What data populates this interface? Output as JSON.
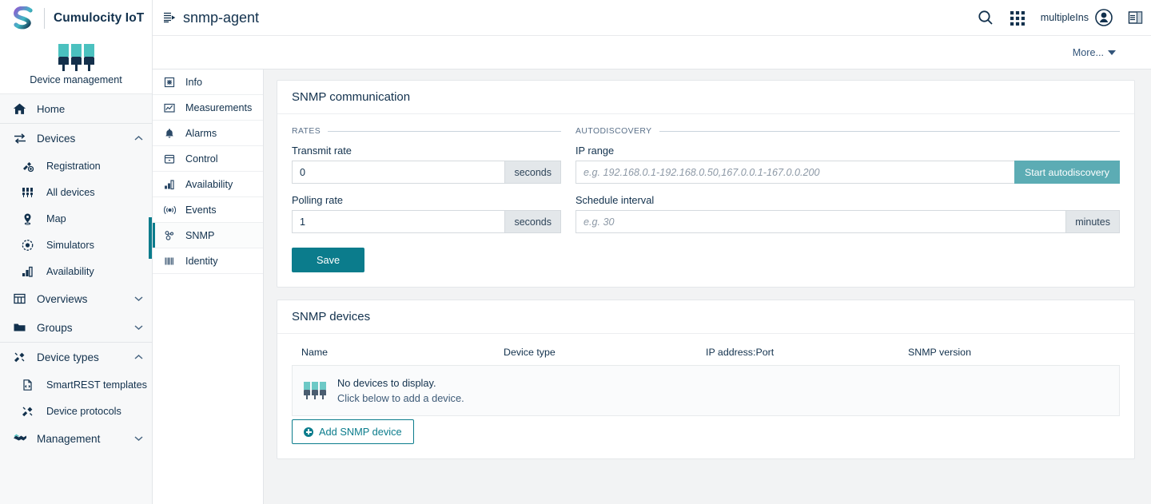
{
  "brand": {
    "name": "Cumulocity IoT",
    "logo_icon": "cumulocity-s-logo",
    "app_title": "Device management",
    "app_icon": "device-management-icon"
  },
  "sidebar": {
    "items": [
      {
        "label": "Home",
        "icon": "home-icon",
        "type": "item"
      },
      {
        "label": "Devices",
        "icon": "devices-icon",
        "type": "group",
        "chevron": "chevron-up",
        "expanded": true
      },
      {
        "label": "Registration",
        "icon": "registration-icon",
        "type": "sub"
      },
      {
        "label": "All devices",
        "icon": "all-devices-icon",
        "type": "sub"
      },
      {
        "label": "Map",
        "icon": "map-pin-icon",
        "type": "sub"
      },
      {
        "label": "Simulators",
        "icon": "simulators-icon",
        "type": "sub"
      },
      {
        "label": "Availability",
        "icon": "availability-icon",
        "type": "sub"
      },
      {
        "label": "Overviews",
        "icon": "overviews-icon",
        "type": "group",
        "chevron": "chevron-down",
        "expanded": false
      },
      {
        "label": "Groups",
        "icon": "folder-icon",
        "type": "group",
        "chevron": "chevron-down",
        "expanded": false
      },
      {
        "label": "Device types",
        "icon": "device-types-icon",
        "type": "group",
        "chevron": "chevron-up",
        "expanded": true
      },
      {
        "label": "SmartREST templates",
        "icon": "file-code-icon",
        "type": "sub"
      },
      {
        "label": "Device protocols",
        "icon": "device-protocols-icon",
        "type": "sub"
      },
      {
        "label": "Management",
        "icon": "management-icon",
        "type": "group",
        "chevron": "chevron-down",
        "expanded": false
      }
    ]
  },
  "topbar": {
    "title": "snmp-agent",
    "title_icon": "device-details-icon",
    "search_icon": "search-icon",
    "apps_icon": "app-switcher-icon",
    "user_name": "multipleIns",
    "user_icon": "user-avatar-icon",
    "collapse_icon": "collapse-panel-icon",
    "more_label": "More...",
    "more_icon": "chevron-down-icon"
  },
  "tabs": [
    {
      "label": "Info",
      "icon": "info-icon",
      "active": false
    },
    {
      "label": "Measurements",
      "icon": "measurements-icon",
      "active": false
    },
    {
      "label": "Alarms",
      "icon": "alarms-bell-icon",
      "active": false
    },
    {
      "label": "Control",
      "icon": "control-icon",
      "active": false
    },
    {
      "label": "Availability",
      "icon": "availability-bars-icon",
      "active": false
    },
    {
      "label": "Events",
      "icon": "events-icon",
      "active": false
    },
    {
      "label": "SNMP",
      "icon": "snmp-icon",
      "active": true
    },
    {
      "label": "Identity",
      "icon": "identity-barcode-icon",
      "active": false
    }
  ],
  "communication": {
    "card_title": "SNMP communication",
    "rates_legend": "RATES",
    "autodiscovery_legend": "AUTODISCOVERY",
    "transmit_rate": {
      "label": "Transmit rate",
      "value": "0",
      "unit": "seconds"
    },
    "polling_rate": {
      "label": "Polling rate",
      "value": "1",
      "unit": "seconds"
    },
    "ip_range": {
      "label": "IP range",
      "value": "",
      "placeholder": "e.g. 192.168.0.1-192.168.0.50,167.0.0.1-167.0.0.200",
      "button_label": "Start autodiscovery"
    },
    "schedule_interval": {
      "label": "Schedule interval",
      "value": "",
      "placeholder": "e.g. 30",
      "unit": "minutes"
    },
    "save_label": "Save"
  },
  "devices": {
    "card_title": "SNMP devices",
    "columns": [
      "Name",
      "Device type",
      "IP address:Port",
      "SNMP version"
    ],
    "rows": [],
    "empty_title": "No devices to display.",
    "empty_hint": "Click below to add a device.",
    "empty_icon": "device-placeholder-icon",
    "add_label": "Add SNMP device",
    "add_icon": "plus-circle-icon"
  },
  "colors": {
    "accent_teal": "#0b7c8c",
    "accent_teal_muted": "#5cacb4",
    "brand_navy": "#12314d",
    "device_green": "#4bc1bf",
    "page_bg": "#f2f3f4"
  }
}
